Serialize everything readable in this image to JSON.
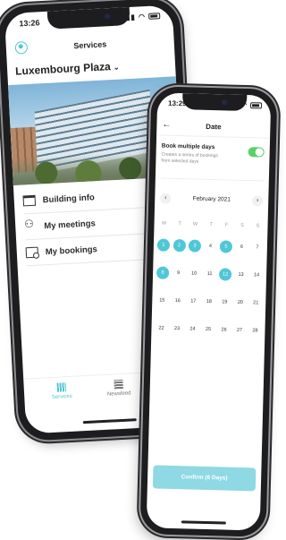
{
  "app_left": {
    "status_time": "13:26",
    "header_title": "Services",
    "location_name": "Luxembourg Plaza",
    "location_chevron": "⌄",
    "menu": [
      {
        "label": "Building info",
        "icon": "building-icon"
      },
      {
        "label": "My meetings",
        "icon": "meetings-icon"
      },
      {
        "label": "My bookings",
        "icon": "calendar-icon"
      }
    ],
    "tabs": [
      {
        "label": "Services",
        "icon": "services-icon",
        "active": true
      },
      {
        "label": "Newsfeed",
        "icon": "newsfeed-icon",
        "active": false
      }
    ]
  },
  "app_right": {
    "status_time": "13:29",
    "back_glyph": "←",
    "title": "Date",
    "toggle_label": "Book multiple days",
    "toggle_help": "Creates a series of bookings from selected days",
    "toggle_on": true,
    "prev_glyph": "‹",
    "next_glyph": "›",
    "month": "February 2021",
    "weekdays": [
      "M",
      "T",
      "W",
      "T",
      "F",
      "S",
      "S"
    ],
    "weeks": [
      [
        "1",
        "2",
        "3",
        "4",
        "5",
        "6",
        "7"
      ],
      [
        "8",
        "9",
        "10",
        "11",
        "12",
        "13",
        "14"
      ],
      [
        "15",
        "16",
        "17",
        "18",
        "19",
        "20",
        "21"
      ],
      [
        "22",
        "23",
        "24",
        "25",
        "26",
        "27",
        "28"
      ]
    ],
    "selected_days": [
      "1",
      "2",
      "3",
      "5",
      "8",
      "12"
    ],
    "confirm_label": "Confirm (6 Days)"
  },
  "colors": {
    "accent": "#4fc7d6",
    "toggle_on": "#5bd06a",
    "confirm_bg": "#8ed9e3"
  }
}
